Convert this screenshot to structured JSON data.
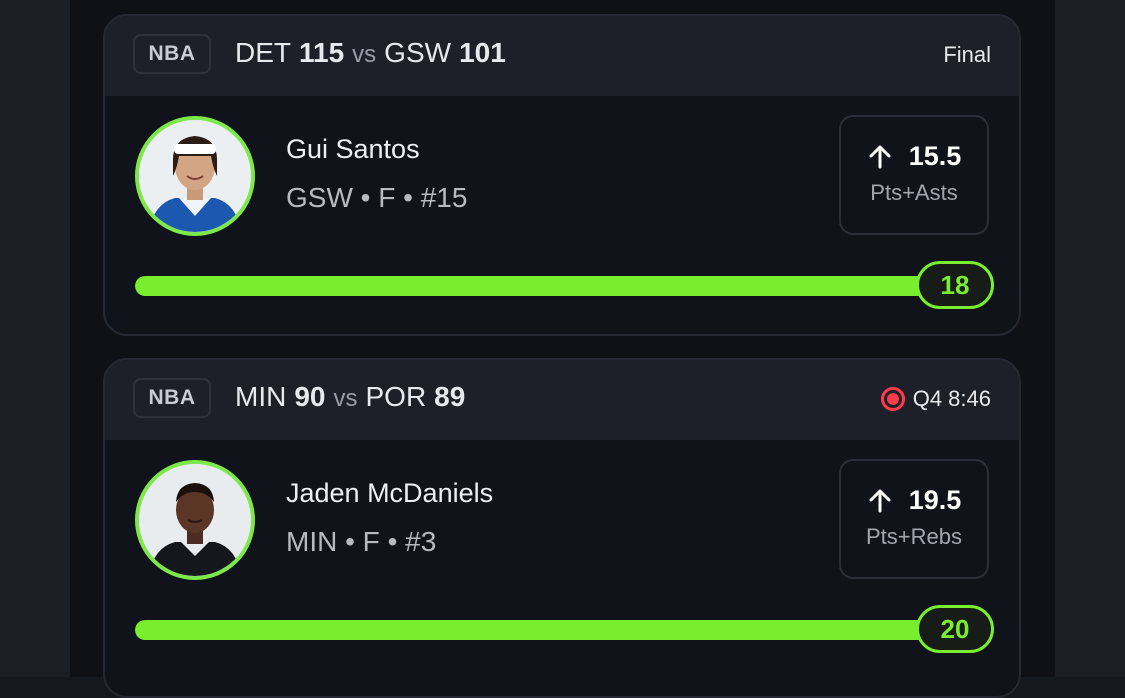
{
  "colors": {
    "accent_green": "#79ee2e",
    "avatar_ring": "#7de84a",
    "live_red": "#ff3b4a",
    "card_bg": "#11131b",
    "header_bg": "#1e2029"
  },
  "cards": [
    {
      "league": "NBA",
      "away_team": "DET",
      "away_score": "115",
      "vs": "vs",
      "home_team": "GSW",
      "home_score": "101",
      "status": "Final",
      "live": false,
      "player": {
        "name": "Gui Santos",
        "meta": "GSW • F • #15",
        "avatar_icon": "player-headshot"
      },
      "pick": {
        "direction_icon": "arrow-up-icon",
        "line": "15.5",
        "stat": "Pts+Asts"
      },
      "result": "18",
      "progress_fraction": 1.0
    },
    {
      "league": "NBA",
      "away_team": "MIN",
      "away_score": "90",
      "vs": "vs",
      "home_team": "POR",
      "home_score": "89",
      "status": "Q4 8:46",
      "live": true,
      "live_icon": "live-indicator-icon",
      "player": {
        "name": "Jaden McDaniels",
        "meta": "MIN • F • #3",
        "avatar_icon": "player-headshot"
      },
      "pick": {
        "direction_icon": "arrow-up-icon",
        "line": "19.5",
        "stat": "Pts+Rebs"
      },
      "result": "20",
      "progress_fraction": 1.0
    }
  ]
}
